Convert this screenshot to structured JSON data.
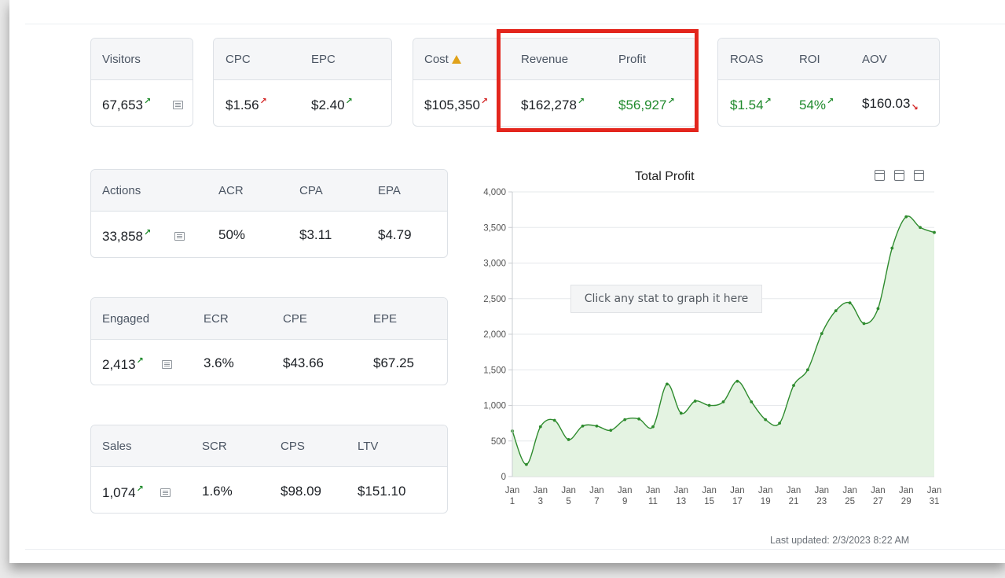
{
  "top_cards": {
    "visitors": {
      "label": "Visitors",
      "value": "67,653"
    },
    "cpc": {
      "label": "CPC",
      "value": "$1.56"
    },
    "epc": {
      "label": "EPC",
      "value": "$2.40"
    },
    "cost": {
      "label": "Cost",
      "value": "$105,350"
    },
    "revenue": {
      "label": "Revenue",
      "value": "$162,278"
    },
    "profit": {
      "label": "Profit",
      "value": "$56,927"
    },
    "roas": {
      "label": "ROAS",
      "value": "$1.54"
    },
    "roi": {
      "label": "ROI",
      "value": "54%"
    },
    "aov": {
      "label": "AOV",
      "value": "$160.03"
    }
  },
  "funnel": {
    "actions": {
      "labels": [
        "Actions",
        "ACR",
        "CPA",
        "EPA"
      ],
      "values": [
        "33,858",
        "50%",
        "$3.11",
        "$4.79"
      ]
    },
    "engaged": {
      "labels": [
        "Engaged",
        "ECR",
        "CPE",
        "EPE"
      ],
      "values": [
        "2,413",
        "3.6%",
        "$43.66",
        "$67.25"
      ]
    },
    "sales": {
      "labels": [
        "Sales",
        "SCR",
        "CPS",
        "LTV"
      ],
      "values": [
        "1,074",
        "1.6%",
        "$98.09",
        "$151.10"
      ]
    }
  },
  "icons": {
    "trend_up": "↗",
    "trend_down": "↘",
    "warning": "warning-triangle-icon",
    "list": "list-icon",
    "calendar": "calendar-icon"
  },
  "colors": {
    "positive": "#1f8a2c",
    "negative": "#d32323",
    "highlight": "#e3261d",
    "chart_line": "#2e8b2e",
    "chart_fill": "#e4f3e2"
  },
  "hint": "Click any stat to graph it here",
  "last_updated": "Last updated: 2/3/2023 8:22 AM",
  "chart_data": {
    "type": "area",
    "title": "Total Profit",
    "xlabel": "",
    "ylabel": "",
    "ylim": [
      0,
      4000
    ],
    "yticks": [
      "0",
      "500",
      "1,000",
      "1,500",
      "2,000",
      "2,500",
      "3,000",
      "3,500",
      "4,000"
    ],
    "xtick_labels": [
      [
        "Jan",
        "1"
      ],
      [
        "Jan",
        "3"
      ],
      [
        "Jan",
        "5"
      ],
      [
        "Jan",
        "7"
      ],
      [
        "Jan",
        "9"
      ],
      [
        "Jan",
        "11"
      ],
      [
        "Jan",
        "13"
      ],
      [
        "Jan",
        "15"
      ],
      [
        "Jan",
        "17"
      ],
      [
        "Jan",
        "19"
      ],
      [
        "Jan",
        "21"
      ],
      [
        "Jan",
        "23"
      ],
      [
        "Jan",
        "25"
      ],
      [
        "Jan",
        "27"
      ],
      [
        "Jan",
        "29"
      ],
      [
        "Jan",
        "31"
      ]
    ],
    "x": [
      1,
      2,
      3,
      4,
      5,
      6,
      7,
      8,
      9,
      10,
      11,
      12,
      13,
      14,
      15,
      16,
      17,
      18,
      19,
      20,
      21,
      22,
      23,
      24,
      25,
      26,
      27,
      28,
      29,
      30,
      31
    ],
    "values": [
      640,
      170,
      700,
      790,
      520,
      710,
      710,
      650,
      800,
      810,
      700,
      1300,
      890,
      1060,
      1000,
      1050,
      1340,
      1050,
      800,
      750,
      1280,
      1500,
      2010,
      2330,
      2440,
      2150,
      2360,
      3210,
      3650,
      3500,
      3430
    ],
    "grid": true,
    "legend": "none"
  }
}
